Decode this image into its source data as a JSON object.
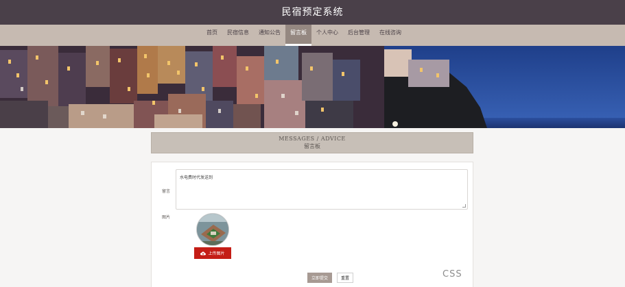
{
  "header": {
    "title": "民宿预定系统"
  },
  "nav": {
    "items": [
      {
        "label": "首页",
        "active": false
      },
      {
        "label": "民宿信息",
        "active": false
      },
      {
        "label": "通知公告",
        "active": false
      },
      {
        "label": "留言板",
        "active": true
      },
      {
        "label": "个人中心",
        "active": false
      },
      {
        "label": "后台管理",
        "active": false
      },
      {
        "label": "在线咨询",
        "active": false
      }
    ]
  },
  "banner": {
    "slides": 3,
    "active_slide": 2
  },
  "section": {
    "title_en": "MESSAGES / ADVICE",
    "title_cn": "留言板"
  },
  "form": {
    "message_label": "留言",
    "message_value": "水电费时代发送到",
    "image_label": "图片",
    "upload_label": "上传图片",
    "submit_label": "立即提交",
    "reset_label": "重置"
  },
  "watermark": "CSS",
  "colors": {
    "topbar": "#4a4049",
    "navbar": "#c6bab1",
    "nav_active": "#958881",
    "upload_button": "#c41d16",
    "submit_button": "#a79a93"
  }
}
